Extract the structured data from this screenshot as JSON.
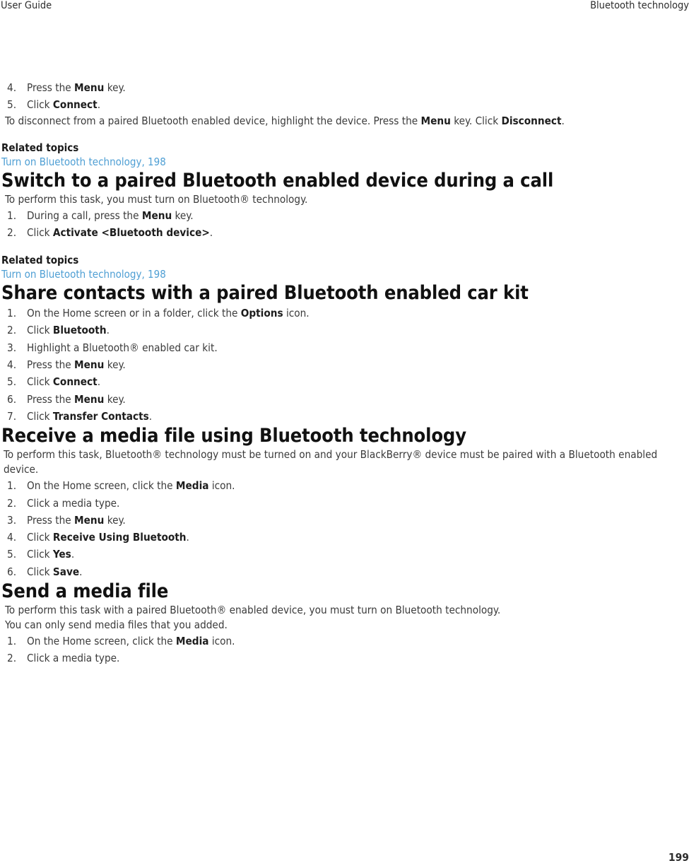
{
  "header": {
    "left": "User Guide",
    "right": "Bluetooth technology"
  },
  "footer": {
    "page_number": "199"
  },
  "colors": {
    "link": "#4f9fd4",
    "heading": "#111111",
    "body": "#3b3b3b"
  },
  "labels": {
    "related_topics": "Related topics"
  },
  "top_section": {
    "steps": [
      {
        "pre": "Press the ",
        "bold": "Menu",
        "post": " key."
      },
      {
        "pre": "Click ",
        "bold": "Connect",
        "post": "."
      }
    ],
    "paragraph_parts": {
      "p1": "To disconnect from a paired Bluetooth enabled device, highlight the device. Press the ",
      "b1": "Menu",
      "p2": " key. Click ",
      "b2": "Disconnect",
      "p3": "."
    },
    "related": {
      "heading": "Related topics",
      "link": "Turn on Bluetooth technology, 198"
    }
  },
  "sections": [
    {
      "title": "Switch to a paired Bluetooth enabled device during a call",
      "intro": "To perform this task, you must turn on Bluetooth® technology.",
      "steps": [
        {
          "pre": "During a call, press the ",
          "bold": "Menu",
          "post": " key."
        },
        {
          "pre": "Click ",
          "bold": "Activate <Bluetooth device>",
          "post": "."
        }
      ],
      "related": {
        "heading": "Related topics",
        "link": "Turn on Bluetooth technology, 198"
      }
    },
    {
      "title": "Share contacts with a paired Bluetooth enabled car kit",
      "steps": [
        {
          "pre": "On the Home screen or in a folder, click the ",
          "bold": "Options",
          "post": " icon."
        },
        {
          "pre": "Click ",
          "bold": "Bluetooth",
          "post": "."
        },
        {
          "pre": "Highlight a Bluetooth® enabled car kit.",
          "bold": "",
          "post": ""
        },
        {
          "pre": "Press the ",
          "bold": "Menu",
          "post": " key."
        },
        {
          "pre": "Click ",
          "bold": "Connect",
          "post": "."
        },
        {
          "pre": "Press the ",
          "bold": "Menu",
          "post": " key."
        },
        {
          "pre": "Click ",
          "bold": "Transfer Contacts",
          "post": "."
        }
      ]
    },
    {
      "title": "Receive a media file using Bluetooth technology",
      "intro": "To perform this task, Bluetooth® technology must be turned on and your BlackBerry® device must be paired with a Bluetooth enabled device.",
      "steps": [
        {
          "pre": "On the Home screen, click the ",
          "bold": "Media",
          "post": " icon."
        },
        {
          "pre": "Click a media type.",
          "bold": "",
          "post": ""
        },
        {
          "pre": "Press the ",
          "bold": "Menu",
          "post": " key."
        },
        {
          "pre": "Click ",
          "bold": "Receive Using Bluetooth",
          "post": "."
        },
        {
          "pre": "Click ",
          "bold": "Yes",
          "post": "."
        },
        {
          "pre": "Click ",
          "bold": "Save",
          "post": "."
        }
      ]
    },
    {
      "title": "Send a media file",
      "intro": "To perform this task with a paired Bluetooth® enabled device, you must turn on Bluetooth technology.",
      "note": "You can only send media files that you added.",
      "steps": [
        {
          "pre": "On the Home screen, click the ",
          "bold": "Media",
          "post": " icon."
        },
        {
          "pre": "Click a media type.",
          "bold": "",
          "post": ""
        }
      ]
    }
  ]
}
